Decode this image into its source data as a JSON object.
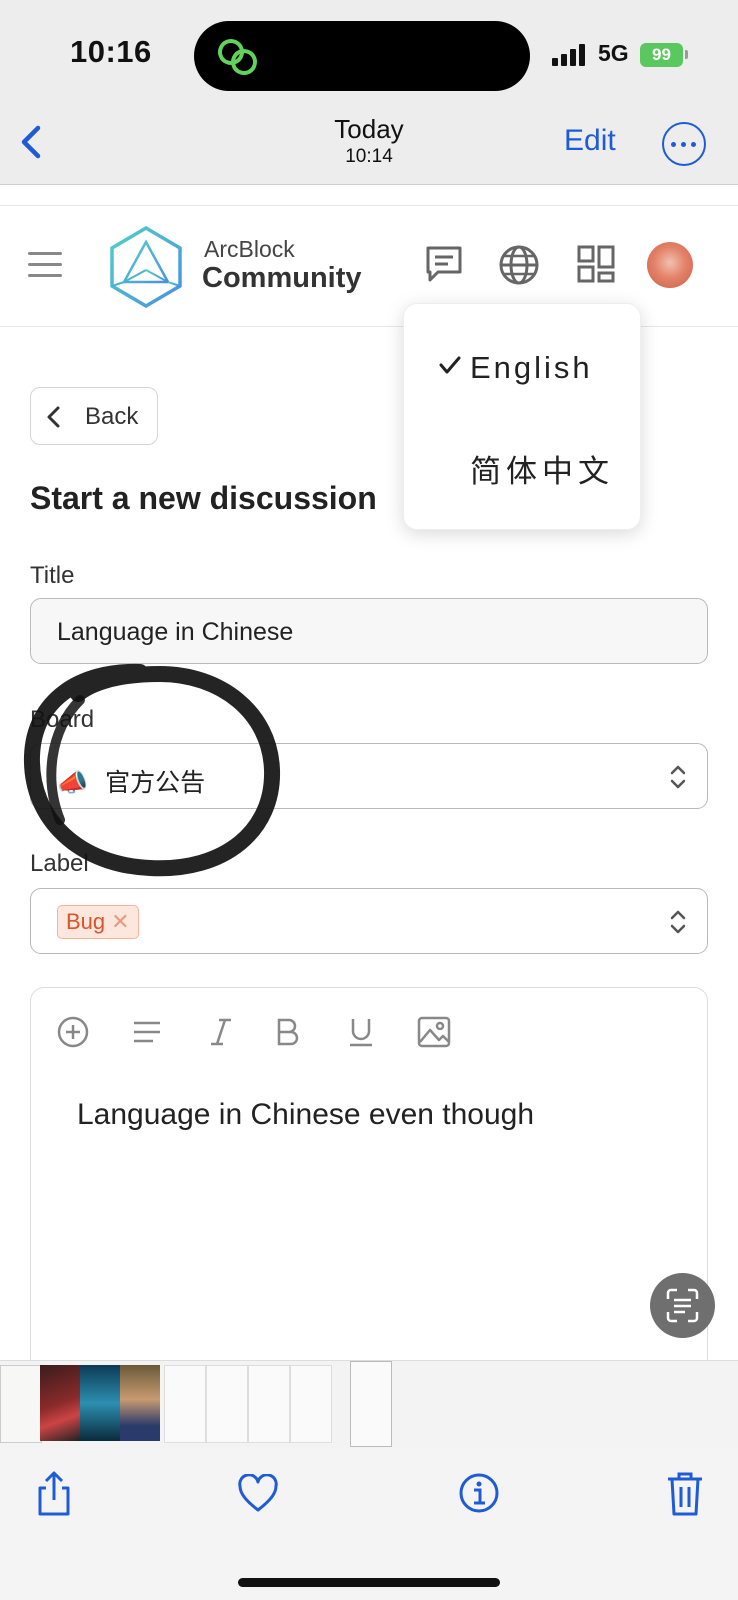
{
  "status_bar": {
    "time": "10:16",
    "network": "5G",
    "battery": "99"
  },
  "nav": {
    "title": "Today",
    "subtitle": "10:14",
    "edit_label": "Edit"
  },
  "header": {
    "brand_top": "ArcBlock",
    "brand_bottom": "Community"
  },
  "language_menu": {
    "items": [
      {
        "label": "English",
        "selected": true
      },
      {
        "label": "简体中文",
        "selected": false
      }
    ]
  },
  "form": {
    "back_label": "Back",
    "page_title": "Start a new discussion",
    "title_label": "Title",
    "title_value": "Language in Chinese",
    "board_label": "Board",
    "board_value": "官方公告",
    "board_emoji": "📣",
    "label_label": "Label",
    "label_chip": "Bug"
  },
  "editor": {
    "content": "Language in Chinese even though"
  },
  "colors": {
    "ios_blue": "#1f5bd6",
    "battery_green": "#5ac85e",
    "chip_text": "#d9552c"
  }
}
